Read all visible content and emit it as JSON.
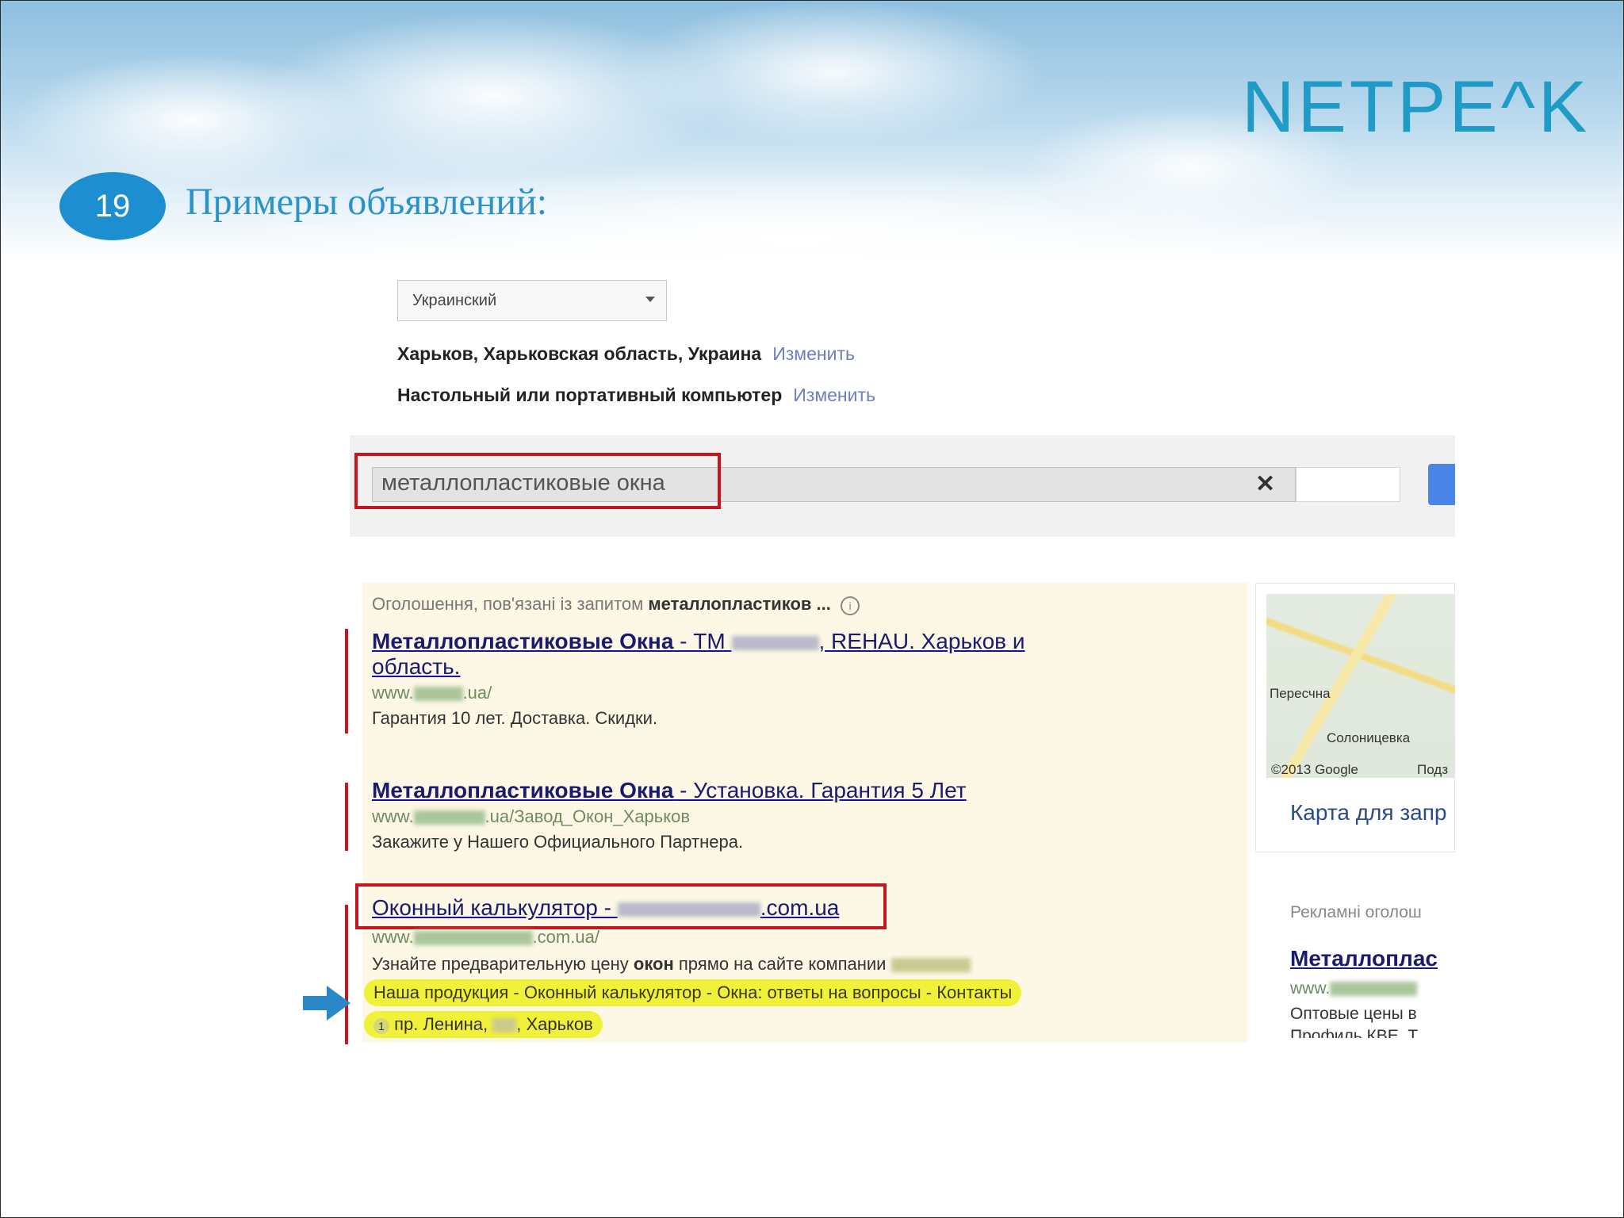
{
  "slide": {
    "logo": "NETPE^K",
    "number": "19",
    "title": "Примеры объявлений:"
  },
  "settings": {
    "language_select": "Украинский",
    "location": "Харьков, Харьковская область, Украина",
    "location_change": "Изменить",
    "device": "Настольный или портативный компьютер",
    "device_change": "Изменить"
  },
  "search": {
    "query": "металлопластиковые окна",
    "clear_icon": "close-icon"
  },
  "ads": {
    "header_prefix": "Оголошення, пов'язані із запитом ",
    "header_query": "металлопластиков ...",
    "header_info_icon": "info-icon",
    "items": [
      {
        "title_bold": "Металлопластиковые Окна",
        "title_rest_1": " - ТМ ",
        "title_rest_2": ", REHAU. Харьков и",
        "title_line2": "область.",
        "url_prefix": "www.",
        "url_suffix": ".ua/",
        "desc": "Гарантия 10 лет. Доставка. Скидки."
      },
      {
        "title_bold": "Металлопластиковые Окна",
        "title_rest": " - Установка. Гарантия 5 Лет",
        "url_prefix": "www.",
        "url_suffix": ".ua/Завод_Окон_Харьков",
        "desc": "Закажите у Нашего Официального Партнера."
      },
      {
        "title_prefix": "Оконный калькулятор - ",
        "title_suffix": ".com.ua",
        "url_prefix": "www.",
        "url_suffix": ".com.ua/",
        "desc_prefix": "Узнайте предварительную цену ",
        "desc_bold": "окон",
        "desc_suffix": " прямо на сайте компании",
        "sitelinks": "Наша продукция - Оконный калькулятор - Окна: ответы на вопросы - Контакты",
        "address_badge": "1",
        "address_prefix": "пр. Ленина, ",
        "address_suffix": ", Харьков"
      }
    ]
  },
  "map": {
    "label_1": "Пересчна",
    "label_2": "Солоницевка",
    "label_3": "©2013 Google",
    "label_4": "Подз",
    "caption": "Карта для запр"
  },
  "side_ads": {
    "header": "Рекламні оголош",
    "title": "Металлоплас",
    "url": "www.",
    "desc": "Оптовые цены в",
    "desc2": "Профиль КВЕ. Т"
  }
}
